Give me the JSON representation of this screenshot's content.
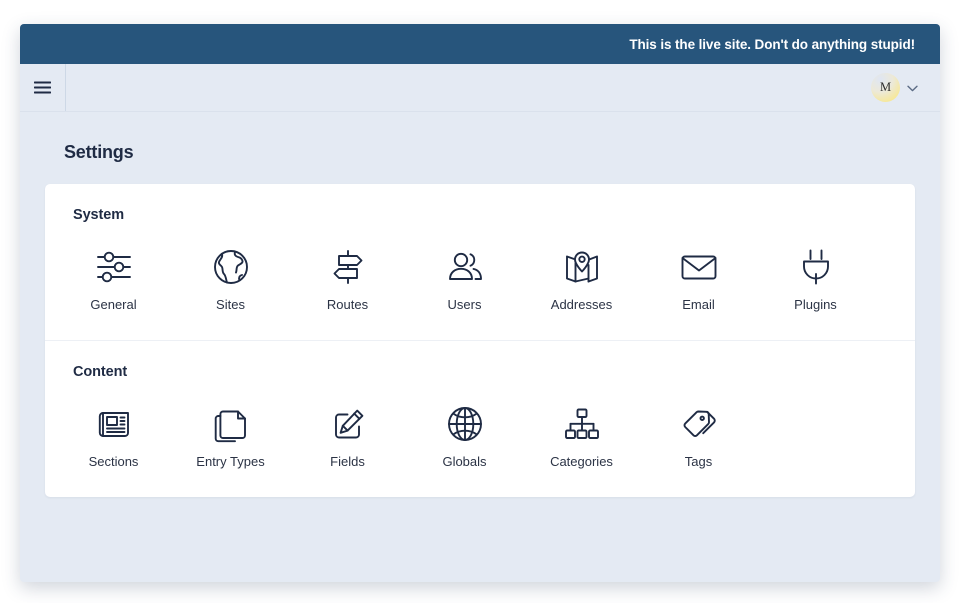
{
  "banner": {
    "text": "This is the live site. Don't do anything stupid!",
    "color": "#27557c"
  },
  "toolbar": {
    "menu_icon": "hamburger-icon",
    "user": {
      "initial": "M",
      "chevron_icon": "chevron-down-icon"
    }
  },
  "page": {
    "title": "Settings"
  },
  "sections": [
    {
      "title": "System",
      "tiles": [
        {
          "label": "General",
          "icon": "sliders-icon"
        },
        {
          "label": "Sites",
          "icon": "globe-earth-icon"
        },
        {
          "label": "Routes",
          "icon": "signpost-icon"
        },
        {
          "label": "Users",
          "icon": "users-icon"
        },
        {
          "label": "Addresses",
          "icon": "map-pin-icon"
        },
        {
          "label": "Email",
          "icon": "envelope-icon"
        },
        {
          "label": "Plugins",
          "icon": "plug-icon"
        }
      ]
    },
    {
      "title": "Content",
      "tiles": [
        {
          "label": "Sections",
          "icon": "newspaper-icon"
        },
        {
          "label": "Entry Types",
          "icon": "documents-icon"
        },
        {
          "label": "Fields",
          "icon": "pencil-square-icon"
        },
        {
          "label": "Globals",
          "icon": "globe-wire-icon"
        },
        {
          "label": "Categories",
          "icon": "hierarchy-tree-icon"
        },
        {
          "label": "Tags",
          "icon": "tags-icon"
        }
      ]
    }
  ],
  "colors": {
    "page_background": "#e4eaf3",
    "card_background": "#ffffff",
    "icon_stroke": "#1f2b44",
    "text": "#2b3345"
  }
}
